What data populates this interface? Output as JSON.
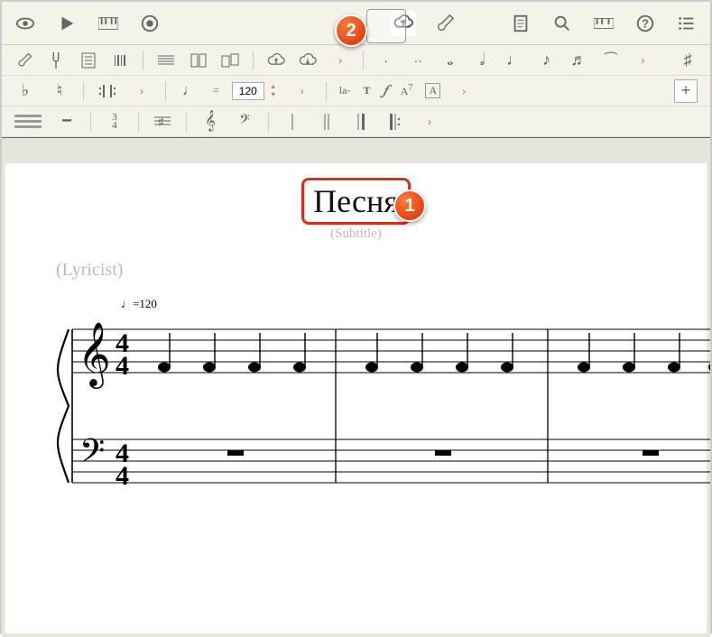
{
  "callouts": {
    "one": "1",
    "two": "2"
  },
  "top": {
    "eye_icon": "eye-icon",
    "play_icon": "play-icon",
    "piano_icon": "piano-icon",
    "record_icon": "record-icon",
    "upload_icon": "cloud-upload-icon",
    "guitar_icon": "guitar-icon",
    "doc_icon": "document-icon",
    "search_icon": "search-icon",
    "mini_piano_icon": "piano-icon",
    "help_icon": "help-icon",
    "list_icon": "list-icon"
  },
  "toolbar_row1": {
    "items": [
      "🎸",
      "⌂",
      "♫",
      "▦",
      "≡",
      "▭",
      "⛉",
      "☁",
      "☁",
      "›",
      "·",
      "·",
      "♩",
      "♪",
      "♫",
      "♬",
      "⁀",
      "›"
    ]
  },
  "toolbar_row2": {
    "flat": "♭",
    "natural": "♮",
    "eq": "=",
    "tempo_value": "120",
    "la": "la-",
    "T": "T",
    "f": "𝆑",
    "A7": "A",
    "A7sup": "7",
    "Abox": "A"
  },
  "toolbar_row3": {
    "time34": "3/4"
  },
  "score": {
    "title": "Песня",
    "subtitle": "(Subtitle)",
    "lyricist": "(Lyricist)",
    "tempo_mark": "♩=120",
    "time_sig": "4/4",
    "clef_treble": "𝄞",
    "clef_bass": "𝄢"
  },
  "chart_data": {
    "type": "music-score",
    "tempo_bpm": 120,
    "time_signature": "4/4",
    "measures": 3,
    "staves": [
      {
        "clef": "treble",
        "notes_per_measure": 4,
        "note_value": "quarter",
        "pattern": "repeated-single-pitch"
      },
      {
        "clef": "bass",
        "notes_per_measure": 0,
        "rests": "whole"
      }
    ]
  }
}
